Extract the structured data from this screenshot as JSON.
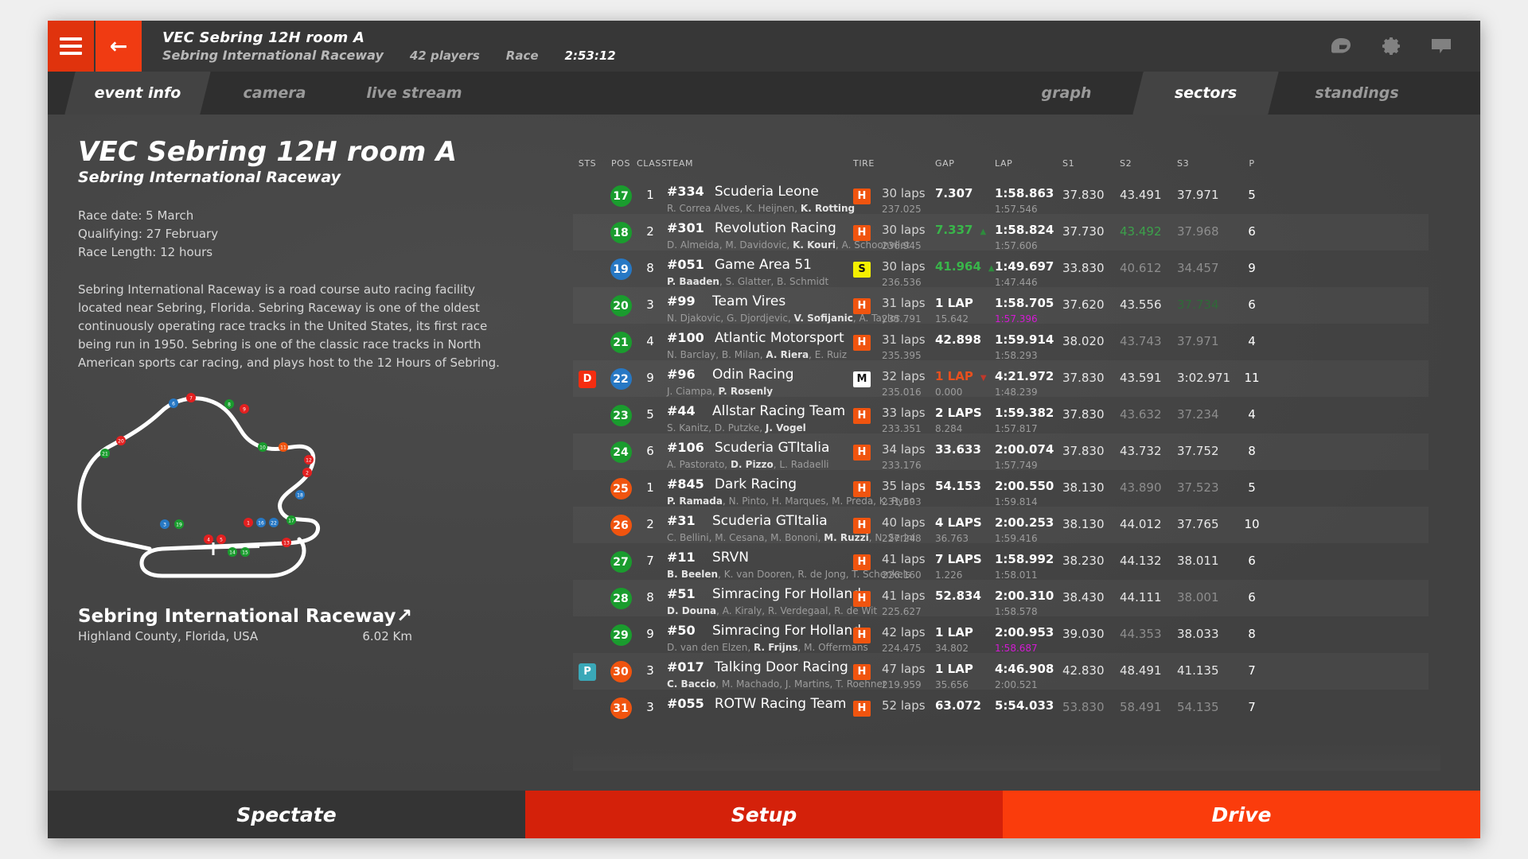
{
  "header": {
    "menu_icon": "hamburger-menu-icon",
    "back_icon": "back-arrow-icon",
    "title": "VEC Sebring 12H room A",
    "subtitle": "Sebring International Raceway",
    "players": "42 players",
    "session_type": "Race",
    "time_remaining": "2:53:12",
    "icons": [
      "helmet-icon",
      "gear-icon",
      "chat-icon"
    ]
  },
  "tabs": {
    "left": [
      {
        "label": "event info",
        "active": true
      },
      {
        "label": "camera",
        "active": false
      },
      {
        "label": "live stream",
        "active": false
      }
    ],
    "right": [
      {
        "label": "graph",
        "active": false
      },
      {
        "label": "sectors",
        "active": true
      },
      {
        "label": "standings",
        "active": false
      }
    ]
  },
  "event": {
    "title": "VEC Sebring 12H room A",
    "subtitle": "Sebring International Raceway",
    "race_date": "Race date: 5 March",
    "qualifying": "Qualifying: 27 February",
    "race_length": "Race Length: 12 hours",
    "description": "Sebring International Raceway is a road course auto racing facility located near Sebring, Florida. Sebring Raceway is one of the oldest continuously operating race tracks in the United States, its first race being run in 1950. Sebring is one of the classic race tracks in North American sports car racing, and plays host to the 12 Hours of Sebring.",
    "venue_name": "Sebring International Raceway",
    "venue_link_icon": "external-link-arrow-icon",
    "venue_location": "Highland County, Florida, USA",
    "venue_length": "6.02 Km"
  },
  "table": {
    "columns": [
      "STS",
      "POS",
      "CLASS",
      "TEAM",
      "TIRE",
      "GAP",
      "LAP",
      "S1",
      "S2",
      "S3",
      "P"
    ],
    "rows": [
      {
        "sts": "",
        "sts_color": "",
        "pos": "17",
        "pos_color": "#1a9c2e",
        "cls": "1",
        "num": "#334",
        "team": "Scuderia Leone",
        "drivers": "R. Correa Alves, K. Heijnen, <b>K. Rotting</b>",
        "tire": "H",
        "tire_bg": "#f0540f",
        "tire_fg": "#ffffff",
        "laps": "30 laps",
        "laps_sub": "237.025",
        "gap": "7.307",
        "gap_style": "white",
        "gap_arrow": "",
        "gap_sub": "",
        "lap": "1:58.863",
        "lap_sub": "1:57.546",
        "lap_sub_style": "",
        "s1": "37.830",
        "s1_style": "",
        "s2": "43.491",
        "s2_style": "",
        "s3": "37.971",
        "s3_style": "",
        "p": "5"
      },
      {
        "sts": "",
        "sts_color": "",
        "pos": "18",
        "pos_color": "#1a9c2e",
        "cls": "2",
        "num": "#301",
        "team": "Revolution Racing",
        "drivers": "D. Almeida, M. Davidovic, <b>K. Kouri</b>, A. Schoonvliet",
        "tire": "H",
        "tire_bg": "#f0540f",
        "tire_fg": "#ffffff",
        "laps": "30 laps",
        "laps_sub": "236.945",
        "gap": "7.337",
        "gap_style": "green",
        "gap_arrow": "up",
        "gap_sub": "",
        "lap": "1:58.824",
        "lap_sub": "1:57.606",
        "lap_sub_style": "",
        "s1": "37.730",
        "s1_style": "",
        "s2": "43.492",
        "s2_style": "green",
        "s3": "37.968",
        "s3_style": "dim",
        "p": "6"
      },
      {
        "sts": "",
        "sts_color": "",
        "pos": "19",
        "pos_color": "#2778c4",
        "cls": "8",
        "num": "#051",
        "team": "Game Area 51",
        "drivers": "<b>P. Baaden</b>, S. Glatter, B. Schmidt",
        "tire": "S",
        "tire_bg": "#f5f000",
        "tire_fg": "#111111",
        "laps": "30 laps",
        "laps_sub": "236.536",
        "gap": "41.964",
        "gap_style": "green",
        "gap_arrow": "up",
        "gap_sub": "",
        "lap": "1:49.697",
        "lap_sub": "1:47.446",
        "lap_sub_style": "",
        "s1": "33.830",
        "s1_style": "",
        "s2": "40.612",
        "s2_style": "dim",
        "s3": "34.457",
        "s3_style": "dim",
        "p": "9"
      },
      {
        "sts": "",
        "sts_color": "",
        "pos": "20",
        "pos_color": "#1a9c2e",
        "cls": "3",
        "num": "#99",
        "team": "Team Vires",
        "drivers": "N. Djakovic, G. Djordjevic, <b>V. Sofijanic</b>, A. Taylor",
        "tire": "H",
        "tire_bg": "#f0540f",
        "tire_fg": "#ffffff",
        "laps": "31 laps",
        "laps_sub": "235.791",
        "gap": "1 LAP",
        "gap_style": "white",
        "gap_arrow": "",
        "gap_sub": "15.642",
        "lap": "1:58.705",
        "lap_sub": "1:57.396",
        "lap_sub_style": "purple",
        "s1": "37.620",
        "s1_style": "",
        "s2": "43.556",
        "s2_style": "",
        "s3": "37.734",
        "s3_style": "dimgreen",
        "p": "6"
      },
      {
        "sts": "",
        "sts_color": "",
        "pos": "21",
        "pos_color": "#1a9c2e",
        "cls": "4",
        "num": "#100",
        "team": "Atlantic Motorsport",
        "drivers": "N. Barclay, B. Milan, <b>A. Riera</b>, E. Ruiz",
        "tire": "H",
        "tire_bg": "#f0540f",
        "tire_fg": "#ffffff",
        "laps": "31 laps",
        "laps_sub": "235.395",
        "gap": "42.898",
        "gap_style": "white",
        "gap_arrow": "",
        "gap_sub": "",
        "lap": "1:59.914",
        "lap_sub": "1:58.293",
        "lap_sub_style": "",
        "s1": "38.020",
        "s1_style": "",
        "s2": "43.743",
        "s2_style": "dim",
        "s3": "37.971",
        "s3_style": "dim",
        "p": "4"
      },
      {
        "sts": "D",
        "sts_color": "#f42d10",
        "pos": "22",
        "pos_color": "#2778c4",
        "cls": "9",
        "num": "#96",
        "team": "Odin Racing",
        "drivers": "J. Ciampa, <b>P. Rosenly</b>",
        "tire": "M",
        "tire_bg": "#ffffff",
        "tire_fg": "#111111",
        "laps": "32 laps",
        "laps_sub": "235.016",
        "gap": "1 LAP",
        "gap_style": "red",
        "gap_arrow": "down",
        "gap_sub": "0.000",
        "lap": "4:21.972",
        "lap_sub": "1:48.239",
        "lap_sub_style": "",
        "s1": "37.830",
        "s1_style": "",
        "s2": "43.591",
        "s2_style": "",
        "s3": "3:02.971",
        "s3_style": "",
        "p": "11"
      },
      {
        "sts": "",
        "sts_color": "",
        "pos": "23",
        "pos_color": "#1a9c2e",
        "cls": "5",
        "num": "#44",
        "team": "Allstar Racing Team",
        "drivers": "S. Kanitz, D. Putzke, <b>J. Vogel</b>",
        "tire": "H",
        "tire_bg": "#f0540f",
        "tire_fg": "#ffffff",
        "laps": "33 laps",
        "laps_sub": "233.351",
        "gap": "2 LAPS",
        "gap_style": "white",
        "gap_arrow": "",
        "gap_sub": "8.284",
        "lap": "1:59.382",
        "lap_sub": "1:57.817",
        "lap_sub_style": "",
        "s1": "37.830",
        "s1_style": "",
        "s2": "43.632",
        "s2_style": "dim",
        "s3": "37.234",
        "s3_style": "dim",
        "p": "4"
      },
      {
        "sts": "",
        "sts_color": "",
        "pos": "24",
        "pos_color": "#1a9c2e",
        "cls": "6",
        "num": "#106",
        "team": "Scuderia GTItalia",
        "drivers": "A. Pastorato, <b>D. Pizzo</b>, L. Radaelli",
        "tire": "H",
        "tire_bg": "#f0540f",
        "tire_fg": "#ffffff",
        "laps": "34 laps",
        "laps_sub": "233.176",
        "gap": "33.633",
        "gap_style": "white",
        "gap_arrow": "",
        "gap_sub": "",
        "lap": "2:00.074",
        "lap_sub": "1:57.749",
        "lap_sub_style": "",
        "s1": "37.830",
        "s1_style": "",
        "s2": "43.732",
        "s2_style": "",
        "s3": "37.752",
        "s3_style": "",
        "p": "8"
      },
      {
        "sts": "",
        "sts_color": "",
        "pos": "25",
        "pos_color": "#f0540f",
        "cls": "1",
        "num": "#845",
        "team": "Dark Racing",
        "drivers": "<b>P. Ramada</b>, N. Pinto, H. Marques, M. Preda, K. Ryan",
        "tire": "H",
        "tire_bg": "#f0540f",
        "tire_fg": "#ffffff",
        "laps": "35 laps",
        "laps_sub": "231.593",
        "gap": "54.153",
        "gap_style": "white",
        "gap_arrow": "",
        "gap_sub": "",
        "lap": "2:00.550",
        "lap_sub": "1:59.814",
        "lap_sub_style": "",
        "s1": "38.130",
        "s1_style": "",
        "s2": "43.890",
        "s2_style": "dim",
        "s3": "37.523",
        "s3_style": "dim",
        "p": "5"
      },
      {
        "sts": "",
        "sts_color": "",
        "pos": "26",
        "pos_color": "#f0540f",
        "cls": "2",
        "num": "#31",
        "team": "Scuderia GTItalia",
        "drivers": "C. Bellini, M. Cesana, M. Bononi, <b>M. Ruzzi</b>, N. Serini",
        "tire": "H",
        "tire_bg": "#f0540f",
        "tire_fg": "#ffffff",
        "laps": "40 laps",
        "laps_sub": "227.248",
        "gap": "4 LAPS",
        "gap_style": "white",
        "gap_arrow": "",
        "gap_sub": "36.763",
        "lap": "2:00.253",
        "lap_sub": "1:59.416",
        "lap_sub_style": "",
        "s1": "38.130",
        "s1_style": "",
        "s2": "44.012",
        "s2_style": "",
        "s3": "37.765",
        "s3_style": "",
        "p": "10"
      },
      {
        "sts": "",
        "sts_color": "",
        "pos": "27",
        "pos_color": "#1a9c2e",
        "cls": "7",
        "num": "#11",
        "team": "SRVN",
        "drivers": "<b>B. Beelen</b>, K. van Dooren, R. de Jong, T. Schenkels",
        "tire": "H",
        "tire_bg": "#f0540f",
        "tire_fg": "#ffffff",
        "laps": "41 laps",
        "laps_sub": "226.160",
        "gap": "7 LAPS",
        "gap_style": "white",
        "gap_arrow": "",
        "gap_sub": "1.226",
        "lap": "1:58.992",
        "lap_sub": "1:58.011",
        "lap_sub_style": "",
        "s1": "38.230",
        "s1_style": "",
        "s2": "44.132",
        "s2_style": "",
        "s3": "38.011",
        "s3_style": "",
        "p": "6"
      },
      {
        "sts": "",
        "sts_color": "",
        "pos": "28",
        "pos_color": "#1a9c2e",
        "cls": "8",
        "num": "#51",
        "team": "Simracing For Holland",
        "drivers": "<b>D. Douna</b>, A. Kiraly, R. Verdegaal, R. de Wit",
        "tire": "H",
        "tire_bg": "#f0540f",
        "tire_fg": "#ffffff",
        "laps": "41 laps",
        "laps_sub": "225.627",
        "gap": "52.834",
        "gap_style": "white",
        "gap_arrow": "",
        "gap_sub": "",
        "lap": "2:00.310",
        "lap_sub": "1:58.578",
        "lap_sub_style": "",
        "s1": "38.430",
        "s1_style": "",
        "s2": "44.111",
        "s2_style": "",
        "s3": "38.001",
        "s3_style": "dim",
        "p": "6"
      },
      {
        "sts": "",
        "sts_color": "",
        "pos": "29",
        "pos_color": "#1a9c2e",
        "cls": "9",
        "num": "#50",
        "team": "Simracing For Holland",
        "drivers": "D. van den Elzen, <b>R. Frijns</b>, M. Offermans",
        "tire": "H",
        "tire_bg": "#f0540f",
        "tire_fg": "#ffffff",
        "laps": "42 laps",
        "laps_sub": "224.475",
        "gap": "1 LAP",
        "gap_style": "white",
        "gap_arrow": "",
        "gap_sub": "34.802",
        "lap": "2:00.953",
        "lap_sub": "1:58.687",
        "lap_sub_style": "purple",
        "s1": "39.030",
        "s1_style": "",
        "s2": "44.353",
        "s2_style": "dim",
        "s3": "38.033",
        "s3_style": "",
        "p": "8"
      },
      {
        "sts": "P",
        "sts_color": "#3aa8b8",
        "pos": "30",
        "pos_color": "#f0540f",
        "cls": "3",
        "num": "#017",
        "team": "Talking Door Racing",
        "drivers": "<b>C. Baccio</b>, M. Machado, J. Martins, T. Roehner",
        "tire": "H",
        "tire_bg": "#f0540f",
        "tire_fg": "#ffffff",
        "laps": "47 laps",
        "laps_sub": "219.959",
        "gap": "1 LAP",
        "gap_style": "white",
        "gap_arrow": "",
        "gap_sub": "35.656",
        "lap": "4:46.908",
        "lap_sub": "2:00.521",
        "lap_sub_style": "",
        "s1": "42.830",
        "s1_style": "",
        "s2": "48.491",
        "s2_style": "",
        "s3": "41.135",
        "s3_style": "",
        "p": "7"
      },
      {
        "sts": "",
        "sts_color": "",
        "pos": "31",
        "pos_color": "#f0540f",
        "cls": "3",
        "num": "#055",
        "team": "ROTW Racing Team",
        "drivers": "",
        "tire": "H",
        "tire_bg": "#f0540f",
        "tire_fg": "#ffffff",
        "laps": "52 laps",
        "laps_sub": "",
        "gap": "63.072",
        "gap_style": "white",
        "gap_arrow": "",
        "gap_sub": "",
        "lap": "5:54.033",
        "lap_sub": "",
        "lap_sub_style": "",
        "s1": "53.830",
        "s1_style": "dim",
        "s2": "58.491",
        "s2_style": "dim",
        "s3": "54.135",
        "s3_style": "dim",
        "p": "7"
      }
    ]
  },
  "footer": {
    "spectate": "Spectate",
    "setup": "Setup",
    "drive": "Drive"
  }
}
